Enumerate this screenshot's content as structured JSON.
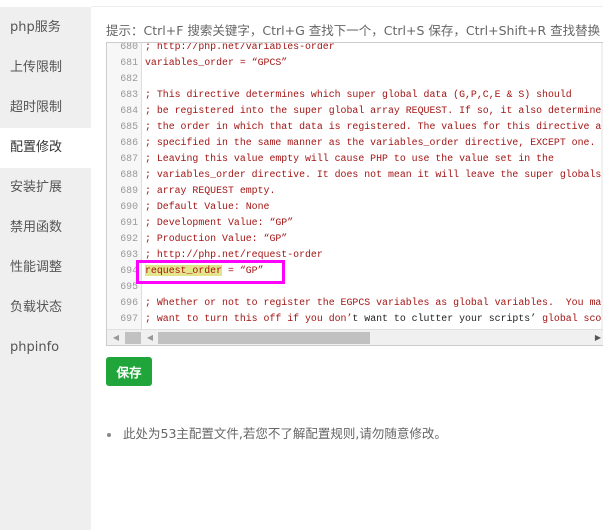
{
  "sidebar": {
    "items": [
      {
        "label": "php服务"
      },
      {
        "label": "上传限制"
      },
      {
        "label": "超时限制"
      },
      {
        "label": "配置修改",
        "active": true
      },
      {
        "label": "安装扩展"
      },
      {
        "label": "禁用函数"
      },
      {
        "label": "性能调整"
      },
      {
        "label": "负载状态"
      },
      {
        "label": "phpinfo"
      }
    ]
  },
  "hint": "提示：Ctrl+F 搜索关键字，Ctrl+G 查找下一个，Ctrl+S 保存，Ctrl+Shift+R 查找替换",
  "editor": {
    "lines": [
      {
        "n": "680",
        "segs": [
          {
            "t": "; http://php.net/variables-order"
          }
        ]
      },
      {
        "n": "681",
        "segs": [
          {
            "t": "variables_order = “GPCS”"
          }
        ]
      },
      {
        "n": "682",
        "segs": [
          {
            "t": ""
          }
        ]
      },
      {
        "n": "683",
        "segs": [
          {
            "t": "; This directive determines which super global data (G,P,C,E & S) should"
          }
        ]
      },
      {
        "n": "684",
        "segs": [
          {
            "t": "; be registered into the super global array REQUEST. If so, it also determines"
          }
        ]
      },
      {
        "n": "685",
        "segs": [
          {
            "t": "; the order in which that data is registered. The values for this directive are"
          }
        ]
      },
      {
        "n": "686",
        "segs": [
          {
            "t": "; specified in the same manner as the variables_order directive, EXCEPT one."
          }
        ]
      },
      {
        "n": "687",
        "segs": [
          {
            "t": "; Leaving this value empty will cause PHP to use the value set in the"
          }
        ]
      },
      {
        "n": "688",
        "segs": [
          {
            "t": "; variables_order directive. It does not mean it will leave the super globals"
          }
        ]
      },
      {
        "n": "689",
        "segs": [
          {
            "t": "; array REQUEST empty."
          }
        ]
      },
      {
        "n": "690",
        "segs": [
          {
            "t": "; Default Value: None"
          }
        ]
      },
      {
        "n": "691",
        "segs": [
          {
            "t": "; Development Value: “GP”"
          }
        ]
      },
      {
        "n": "692",
        "segs": [
          {
            "t": "; Production Value: “GP”"
          }
        ]
      },
      {
        "n": "693",
        "segs": [
          {
            "t": "; http://php.net/request-order"
          }
        ]
      },
      {
        "n": "694",
        "segs": [
          {
            "t": "request_order",
            "hl": true
          },
          {
            "t": " = “GP”"
          }
        ]
      },
      {
        "n": "695",
        "segs": [
          {
            "t": ""
          }
        ]
      },
      {
        "n": "696",
        "segs": [
          {
            "t": "; Whether or not to register the EGPCS variables as global variables.  You may"
          }
        ]
      },
      {
        "n": "697",
        "segs": [
          {
            "t": "; want to turn this off if you don’"
          },
          {
            "t": "t want to clutter your scripts’",
            "plain": true
          },
          {
            "t": " global scope"
          }
        ]
      }
    ],
    "highlighted_line": "694"
  },
  "save_label": "保存",
  "note": "此处为53主配置文件,若您不了解配置规则,请勿随意修改。",
  "colors": {
    "accent": "#20a53a",
    "comment": "#a31515",
    "highlight_box": "#ff00ff"
  }
}
